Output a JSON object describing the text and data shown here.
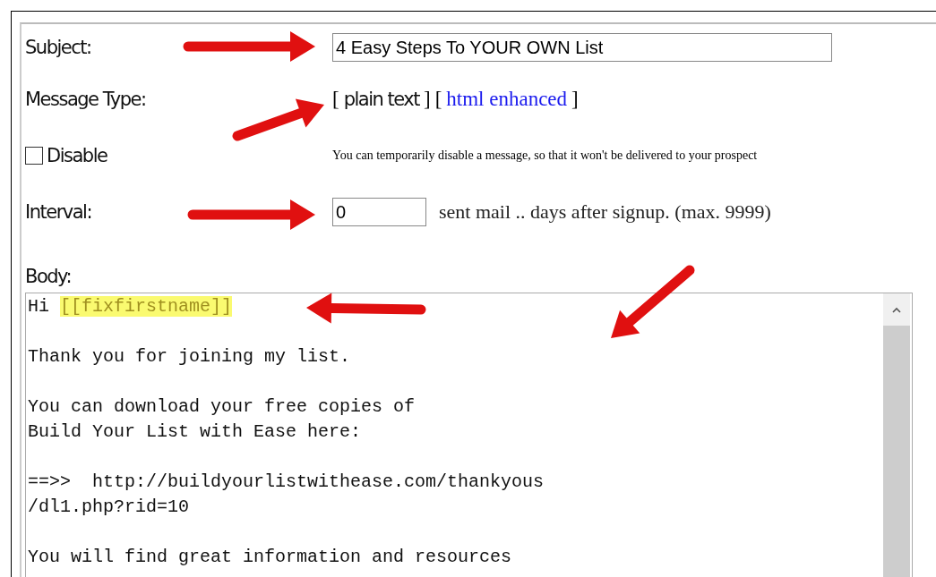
{
  "subject": {
    "label": "Subject:",
    "value": "4 Easy Steps To YOUR OWN List"
  },
  "message_type": {
    "label": "Message Type:",
    "bracket_open": "[",
    "bracket_close": "]",
    "options": [
      {
        "label": "plain text",
        "selected": true
      },
      {
        "label": "html enhanced",
        "selected": false
      }
    ]
  },
  "disable": {
    "label": "Disable",
    "checked": false,
    "note": "You can temporarily disable a message, so that it won't be delivered to your prospect"
  },
  "interval": {
    "label": "Interval:",
    "value": "0",
    "suffix": "sent mail .. days after signup. (max. 9999)"
  },
  "body": {
    "label": "Body:",
    "greeting": "Hi",
    "merge_tag": "[[fixfirstname]]",
    "paragraphs": [
      [
        "Thank you for joining my list."
      ],
      [
        "You can download your free copies of",
        "Build Your List with Ease here:"
      ],
      [
        "==>>  http://buildyourlistwithease.com/thankyous",
        "/dl1.php?rid=10"
      ],
      [
        "You will find great information and resources"
      ]
    ]
  }
}
